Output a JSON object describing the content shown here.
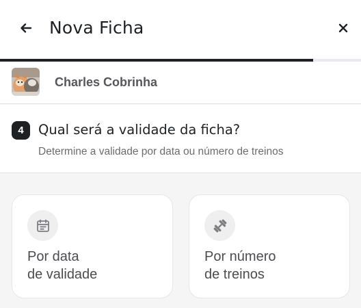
{
  "header": {
    "title": "Nova Ficha",
    "back_icon": "arrow-left-icon",
    "close_icon": "close-icon"
  },
  "progress": {
    "value": 0.867,
    "fill_color": "#1e2124",
    "track_color": "#ebe9f4"
  },
  "client": {
    "name": "Charles Cobrinha",
    "avatar": "cats-photo"
  },
  "step": {
    "number": "4",
    "title": "Qual será a validade da ficha?",
    "subtitle": "Determine a validade por data ou número de treinos"
  },
  "options": [
    {
      "icon": "calendar-icon",
      "line1": "Por data",
      "line2": "de validade"
    },
    {
      "icon": "dumbbell-icon",
      "line1": "Por número",
      "line2": "de treinos"
    }
  ]
}
